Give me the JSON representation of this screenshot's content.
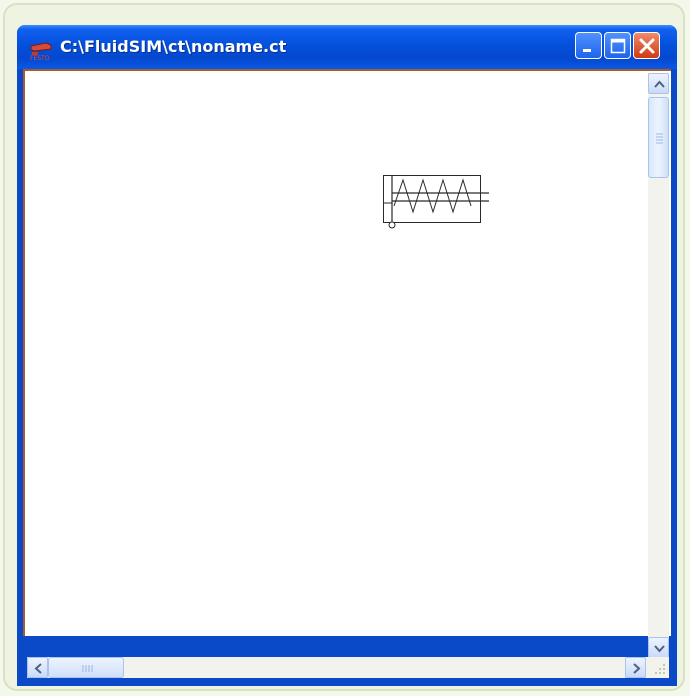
{
  "window": {
    "title": "C:\\FluidSIM\\ct\\noname.ct",
    "app_icon": "festo-icon",
    "controls": [
      "minimize-icon",
      "maximize-icon",
      "close-icon"
    ]
  },
  "canvas": {
    "background": "#ffffff",
    "components": [
      {
        "type": "spring-return cylinder symbol"
      }
    ]
  },
  "scrollbars": {
    "vertical": {
      "up_icon": "chevron-up-icon",
      "down_icon": "chevron-down-icon"
    },
    "horizontal": {
      "left_icon": "chevron-left-icon",
      "right_icon": "chevron-right-icon"
    }
  },
  "colors": {
    "titlebar": "#0451dc",
    "close_button": "#cf3a12",
    "canvas_border": "#a95a2c"
  }
}
